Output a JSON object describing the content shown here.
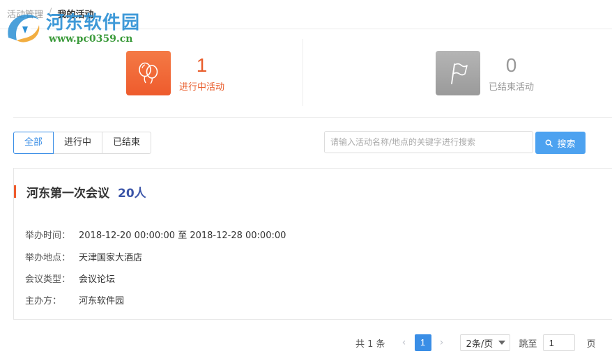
{
  "breadcrumb": {
    "parent": "活动管理",
    "separator": "/",
    "current": "我的活动"
  },
  "watermark": {
    "title": "河东软件园",
    "url": "www.pc0359.cn"
  },
  "stats": {
    "ongoing": {
      "count": "1",
      "label": "进行中活动",
      "icon": "balloons-icon",
      "color": "#f26a3a"
    },
    "ended": {
      "count": "0",
      "label": "已结束活动",
      "icon": "flag-icon",
      "color": "#a6a6a6"
    }
  },
  "filters": {
    "tabs": [
      {
        "label": "全部",
        "active": true
      },
      {
        "label": "进行中",
        "active": false
      },
      {
        "label": "已结束",
        "active": false
      }
    ]
  },
  "search": {
    "placeholder": "请输入活动名称/地点的关键字进行搜索",
    "value": "",
    "button_label": "搜索",
    "icon": "search-icon"
  },
  "activity": {
    "title": "河东第一次会议",
    "people": "20人",
    "rows": [
      {
        "key": "举办时间：",
        "value": "2018-12-20 00:00:00 至 2018-12-28 00:00:00"
      },
      {
        "key": "举办地点：",
        "value": "天津国家大酒店"
      },
      {
        "key": "会议类型：",
        "value": "会议论坛"
      },
      {
        "key": "主办方：",
        "value": "河东软件园"
      }
    ]
  },
  "pagination": {
    "total": "共 1 条",
    "current_page": "1",
    "page_size": "2条/页",
    "jump_label": "跳至",
    "jump_value": "1",
    "page_unit": "页"
  },
  "colors": {
    "accent": "#3a8ee6",
    "orange": "#ee5b2d",
    "people": "#3b55a8"
  }
}
